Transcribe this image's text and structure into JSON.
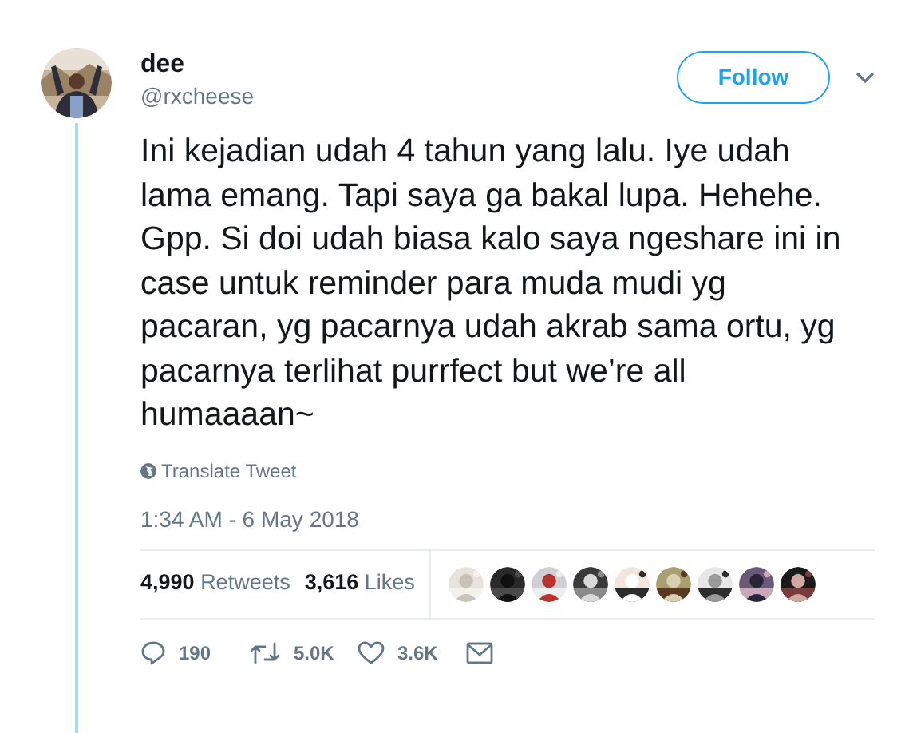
{
  "author": {
    "name": "dee",
    "handle": "@rxcheese"
  },
  "follow_button": "Follow",
  "tweet_text": "Ini kejadian udah 4 tahun yang lalu. Iye udah lama emang. Tapi saya ga bakal lupa. Hehehe. Gpp. Si doi udah biasa kalo saya ngeshare ini in case untuk reminder para muda mudi yg pacaran, yg pacarnya udah akrab sama ortu, yg pacarnya terlihat purrfect but we’re all humaaaan~",
  "translate_link": "Translate Tweet",
  "timestamp": "1:34 AM - 6 May 2018",
  "stats": [
    {
      "count": "4,990",
      "label": "Retweets"
    },
    {
      "count": "3,616",
      "label": "Likes"
    }
  ],
  "actions": [
    {
      "kind": "reply",
      "count": "190"
    },
    {
      "kind": "retweet",
      "count": "5.0K"
    },
    {
      "kind": "like",
      "count": "3.6K"
    },
    {
      "kind": "message"
    }
  ]
}
